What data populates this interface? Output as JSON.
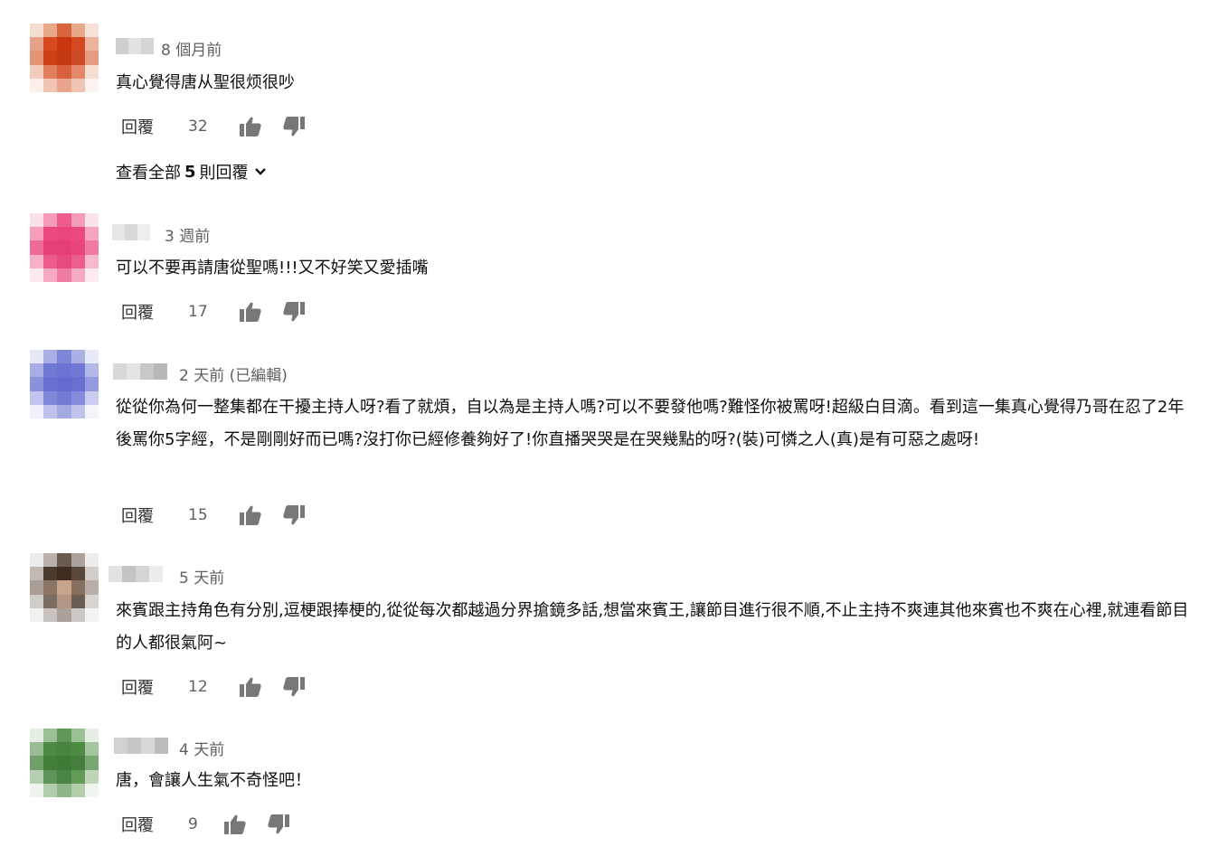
{
  "comments": [
    {
      "time": "8 個月前",
      "text": "真心覺得唐从聖很烦很吵",
      "reply_label": "回覆",
      "likes": "32",
      "view_replies": {
        "prefix": "查看全部",
        "count": "5",
        "suffix": "則回覆"
      },
      "avatar_colors": [
        "#f4dccf",
        "#e8a98b",
        "#d9653f",
        "#e8a98b",
        "#f6e2d8",
        "#e7a08a",
        "#d4491f",
        "#c9350f",
        "#d4491f",
        "#ecb29c",
        "#e39475",
        "#cc3f13",
        "#c53a10",
        "#cc4a24",
        "#e69a7f",
        "#f2ccbd",
        "#e17e5d",
        "#d9613c",
        "#e4876a",
        "#f5ddd2",
        "#fbefe9",
        "#f0c3b2",
        "#e9a48b",
        "#f0c4b3",
        "#fcf2ee"
      ]
    },
    {
      "time": "3 週前",
      "text": "可以不要再請唐從聖嗎!!!又不好笑又愛插嘴",
      "reply_label": "回覆",
      "likes": "17",
      "avatar_colors": [
        "#fbe0ea",
        "#f59ab8",
        "#ee5c8f",
        "#f59ab8",
        "#fbe2eb",
        "#f59dbb",
        "#ea4a80",
        "#e8467d",
        "#ea4a80",
        "#f6a4c1",
        "#ee6b98",
        "#e74079",
        "#e63e77",
        "#e8457c",
        "#f07aa2",
        "#f7b0c8",
        "#ec5b8c",
        "#e84a80",
        "#ed5e8e",
        "#f8b9ce",
        "#fde8ef",
        "#f6a9c2",
        "#f07ca2",
        "#f6aac3",
        "#fdebf1"
      ]
    },
    {
      "time": "2 天前 (已編輯)",
      "text": "從從你為何一整集都在干擾主持人呀?看了就煩，自以為是主持人嗎?可以不要發他嗎?難怪你被罵呀!超級白目滴。看到這一集真心覺得乃哥在忍了2年後罵你5字經，不是剛剛好而已嗎?沒打你已經修養夠好了!你直播哭哭是在哭幾點的呀?(裝)可憐之人(真)是有可惡之處呀!",
      "reply_label": "回覆",
      "likes": "15",
      "avatar_colors": [
        "#e6e8f7",
        "#aab0e6",
        "#7e86d9",
        "#aab0e6",
        "#e8eaf8",
        "#a8aee5",
        "#6f78d3",
        "#6a73d1",
        "#6f78d3",
        "#b3b8e9",
        "#8b92dc",
        "#6770d0",
        "#646dcf",
        "#6871d1",
        "#939ae0",
        "#c1c5ed",
        "#7f87d9",
        "#727bd4",
        "#858cdb",
        "#cacdf0",
        "#eff0fa",
        "#bfc3ec",
        "#a3a9e3",
        "#c0c4ed",
        "#f2f3fb"
      ]
    },
    {
      "time": "5 天前",
      "text": "來賓跟主持角色有分別,逗梗跟捧梗的,從從每次都越過分界搶鏡多話,想當來賓王,讓節目進行很不順,不止主持不爽連其他來賓也不爽在心裡,就連看節目的人都很氣阿~",
      "reply_label": "回覆",
      "likes": "12",
      "avatar_colors": [
        "#ececea",
        "#b9b3ad",
        "#6b5a4e",
        "#aaa39b",
        "#ededec",
        "#c0bab3",
        "#4d3a2e",
        "#3f2c22",
        "#5a463a",
        "#d2cdc8",
        "#a89e95",
        "#8a7464",
        "#c9a48c",
        "#85705f",
        "#b8b0a8",
        "#cfcbc6",
        "#7c6d62",
        "#b59683",
        "#6c5d52",
        "#d8d4d0",
        "#f2f1f0",
        "#c9c4bf",
        "#aaa29a",
        "#cdc8c3",
        "#f4f3f2"
      ]
    },
    {
      "time": "4 天前",
      "text": "唐，會讓人生氣不奇怪吧！",
      "reply_label": "回覆",
      "likes": "9",
      "avatar_colors": [
        "#e4eee2",
        "#9cc096",
        "#5f9857",
        "#9cc096",
        "#e6efe4",
        "#98bd92",
        "#4d8a44",
        "#47853e",
        "#4d8a44",
        "#a5c59f",
        "#6fa068",
        "#437f3b",
        "#3f7b37",
        "#44803c",
        "#78a771",
        "#b4cfaf",
        "#5e9457",
        "#4b8543",
        "#629a5a",
        "#bed5ba",
        "#eef4ed",
        "#b1cdac",
        "#8fb689",
        "#b2cead",
        "#f0f6ef"
      ]
    }
  ]
}
